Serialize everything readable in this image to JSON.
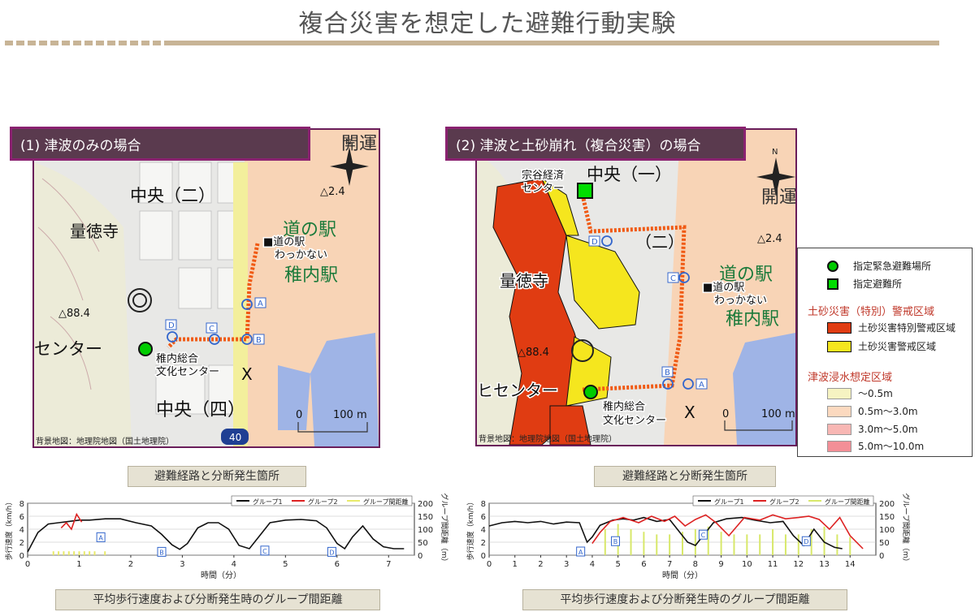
{
  "page": {
    "title": "複合災害を想定した避難行動実験"
  },
  "panel1": {
    "label": "(1) 津波のみの場合",
    "caption": "避難経路と分断発生箇所",
    "map_text": {
      "area_top": "中央（二）",
      "temple": "量徳寺",
      "station_label": "道の駅",
      "station_name": "稚内駅",
      "unknown_note": "■道の駅\nわっかない",
      "center_left": "センター",
      "center_name": "稚内総合\n文化センター",
      "area_bottom": "中央（四）",
      "elev1": "△88.4",
      "elev2": "△2.4",
      "cut": "X",
      "road_no": "40",
      "scale_0": "0",
      "scale_100": "100 m",
      "credit": "背景地図：地理院地図（国土地理院）",
      "north": "N",
      "big_label": "開運",
      "points": [
        "A",
        "B",
        "C",
        "D"
      ]
    }
  },
  "panel2": {
    "label": "(2) 津波と土砂崩れ（複合災害）の場合",
    "caption": "避難経路と分断発生箇所",
    "map_text": {
      "area_top": "中央（一）",
      "area_mid": "（二）",
      "temple": "量徳寺",
      "station_label": "道の駅",
      "station_name": "稚内駅",
      "unknown_note": "■道の駅\nわっかない",
      "center_left": "ヒセンター",
      "center_name": "稚内総合\n文化センター",
      "shelter": "宗谷経済\nセンター",
      "elev1": "△88.4",
      "elev2": "△2.4",
      "cut": "X",
      "scale_0": "0",
      "scale_100": "100 m",
      "credit": "背景地図：地理院地図（国土地理院）",
      "north": "N",
      "big_label": "開運",
      "points": [
        "A",
        "B",
        "C",
        "D"
      ]
    }
  },
  "legend": {
    "emergency_shelter": "指定緊急避難場所",
    "shelter": "指定避難所",
    "landslide_header": "土砂災害（特別）警戒区域",
    "landslide_special": "土砂災害特別警戒区域",
    "landslide_warning": "土砂災害警戒区域",
    "tsunami_header": "津波浸水想定区域",
    "depth_1": "～0.5m",
    "depth_2": "0.5m～3.0m",
    "depth_3": "3.0m～5.0m",
    "depth_4": "5.0m～10.0m",
    "colors": {
      "emergency": "#00cc00",
      "special": "#e03c12",
      "warning": "#f5e61e",
      "d1": "#f6f3c2",
      "d2": "#fbd9bf",
      "d3": "#f8b7b4",
      "d4": "#f38f97"
    }
  },
  "chart_data": [
    {
      "type": "line",
      "caption": "平均歩行速度および分断発生時のグループ間距離",
      "xlabel": "時間（分）",
      "ylabel_left": "歩行速度（km/h）",
      "ylabel_right": "グループ間距離（m）",
      "xlim": [
        0,
        7.5
      ],
      "ylim_left": [
        0,
        8
      ],
      "ylim_right": [
        0,
        200
      ],
      "x_ticks": [
        "0",
        "1",
        "2",
        "3",
        "4",
        "5",
        "6",
        "7"
      ],
      "y_ticks_left": [
        "0",
        "2",
        "4",
        "6",
        "8"
      ],
      "y_ticks_right": [
        "0",
        "50",
        "100",
        "150",
        "200"
      ],
      "series": [
        {
          "name": "グループ1",
          "color": "#111111",
          "x": [
            0,
            0.2,
            0.4,
            0.6,
            0.8,
            1.0,
            1.2,
            1.5,
            1.8,
            2.1,
            2.4,
            2.6,
            2.8,
            2.95,
            3.1,
            3.3,
            3.5,
            3.7,
            3.9,
            4.1,
            4.3,
            4.5,
            4.7,
            5.0,
            5.3,
            5.6,
            5.8,
            6.0,
            6.15,
            6.3,
            6.5,
            6.7,
            6.9,
            7.1,
            7.3
          ],
          "y": [
            0.5,
            3.5,
            4.8,
            5.0,
            5.2,
            5.4,
            5.4,
            5.6,
            5.6,
            5.0,
            4.5,
            3.2,
            1.6,
            0.9,
            1.8,
            4.2,
            5.0,
            5.0,
            4.0,
            1.5,
            1.0,
            3.0,
            5.0,
            5.4,
            5.5,
            5.3,
            4.2,
            1.8,
            1.0,
            2.8,
            4.5,
            2.5,
            1.3,
            1.0,
            1.0
          ]
        },
        {
          "name": "グループ2",
          "color": "#dd2222",
          "x": [
            0.65,
            0.75,
            0.85,
            0.95,
            1.05
          ],
          "y": [
            4.2,
            5.0,
            4.0,
            6.3,
            5.1
          ]
        },
        {
          "name": "グループ間距離",
          "color": "#e8ea6a",
          "x": [
            0.5,
            0.6,
            0.7,
            0.8,
            0.9,
            1.0,
            1.1,
            1.2,
            1.3,
            1.5
          ],
          "y": [
            15,
            15,
            15,
            15,
            15,
            15,
            15,
            15,
            15,
            15
          ]
        }
      ],
      "markers": [
        {
          "label": "A",
          "x": 1.42,
          "y": 2.7
        },
        {
          "label": "B",
          "x": 2.6,
          "y": 0.45
        },
        {
          "label": "C",
          "x": 4.6,
          "y": 0.65
        },
        {
          "label": "D",
          "x": 5.9,
          "y": 0.45
        }
      ]
    },
    {
      "type": "line",
      "caption": "平均歩行速度および分断発生時のグループ間距離",
      "xlabel": "時間（分）",
      "ylabel_left": "歩行速度（km/h）",
      "ylabel_right": "グループ間距離（m）",
      "xlim": [
        0,
        15
      ],
      "ylim_left": [
        0,
        8
      ],
      "ylim_right": [
        0,
        200
      ],
      "x_ticks": [
        "0",
        "1",
        "2",
        "3",
        "4",
        "5",
        "6",
        "7",
        "8",
        "9",
        "10",
        "11",
        "12",
        "13",
        "14"
      ],
      "y_ticks_left": [
        "0",
        "2",
        "4",
        "6",
        "8"
      ],
      "y_ticks_right": [
        "0",
        "50",
        "100",
        "150",
        "200"
      ],
      "series": [
        {
          "name": "グループ1",
          "color": "#111111",
          "x": [
            0,
            0.5,
            1,
            1.5,
            2,
            2.5,
            3,
            3.5,
            3.8,
            4.0,
            4.3,
            4.8,
            5.2,
            5.6,
            6.0,
            6.5,
            7.0,
            7.4,
            7.7,
            8.0,
            8.3,
            8.7,
            9.2,
            9.8,
            10.3,
            10.9,
            11.4,
            11.8,
            12.2,
            12.6,
            13.0,
            13.4,
            13.7
          ],
          "y": [
            4.5,
            5.0,
            5.2,
            5.0,
            5.2,
            4.8,
            5.1,
            5.0,
            2.0,
            2.8,
            4.6,
            5.4,
            5.6,
            5.4,
            5.8,
            5.2,
            5.5,
            3.5,
            2.0,
            1.5,
            3.0,
            5.0,
            5.6,
            5.8,
            5.4,
            5.0,
            5.2,
            3.0,
            1.5,
            4.0,
            2.0,
            1.2,
            1.0
          ]
        },
        {
          "name": "グループ2",
          "color": "#dd2222",
          "x": [
            4.0,
            4.3,
            4.7,
            5.2,
            5.8,
            6.3,
            6.8,
            7.2,
            7.6,
            8.0,
            8.4,
            8.8,
            9.3,
            9.9,
            10.5,
            11.0,
            11.5,
            12.0,
            12.4,
            12.8,
            13.2,
            13.6,
            14.0,
            14.5
          ],
          "y": [
            1.8,
            3.5,
            5.2,
            5.8,
            5.0,
            6.0,
            5.2,
            6.0,
            4.5,
            5.5,
            6.2,
            5.0,
            3.0,
            5.8,
            5.4,
            6.2,
            5.6,
            5.8,
            6.0,
            5.5,
            4.0,
            5.8,
            3.0,
            1.0
          ]
        },
        {
          "name": "グループ間距離",
          "color": "#d8e86a",
          "x": [
            4.5,
            5.0,
            5.5,
            6.0,
            6.5,
            7.0,
            7.5,
            8.0,
            8.5,
            9.0,
            9.5,
            10.0,
            10.5,
            11.0,
            11.5,
            12.0,
            12.5,
            13.0,
            13.5,
            14.0
          ],
          "y": [
            100,
            120,
            100,
            90,
            80,
            80,
            90,
            100,
            110,
            90,
            80,
            80,
            80,
            100,
            80,
            80,
            100,
            110,
            80,
            70
          ]
        }
      ],
      "markers": [
        {
          "label": "A",
          "x": 3.55,
          "y": 0.5
        },
        {
          "label": "B",
          "x": 4.9,
          "y": 2.1
        },
        {
          "label": "C",
          "x": 8.3,
          "y": 3.1
        },
        {
          "label": "D",
          "x": 12.3,
          "y": 2.1
        }
      ]
    }
  ]
}
